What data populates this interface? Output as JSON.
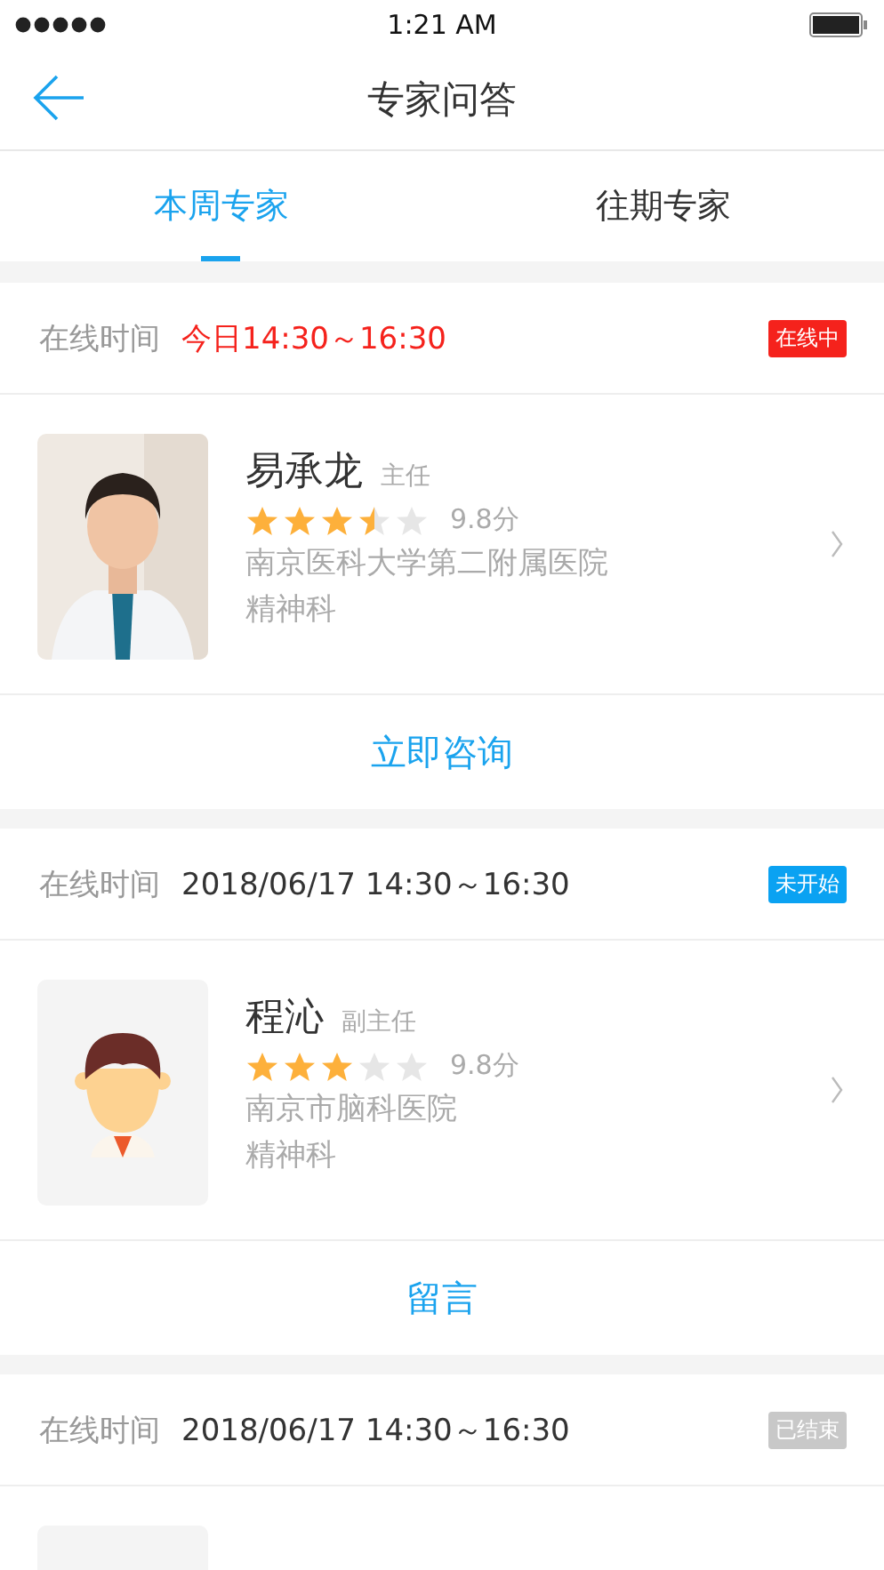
{
  "status_bar": {
    "time": "1:21 AM"
  },
  "nav": {
    "title": "专家问答"
  },
  "tabs": [
    {
      "label": "本周专家",
      "selected": true
    },
    {
      "label": "往期专家",
      "selected": false
    }
  ],
  "experts": [
    {
      "time_label": "在线时间",
      "time": "今日14:30～16:30",
      "status": {
        "kind": "online",
        "label": "在线中"
      },
      "name": "易承龙",
      "title": "主任",
      "stars": 3.5,
      "score": "9.8分",
      "hospital": "南京医科大学第二附属医院",
      "department": "精神科",
      "action": "立即咨询"
    },
    {
      "time_label": "在线时间",
      "time": "2018/06/17 14:30～16:30",
      "status": {
        "kind": "pending",
        "label": "未开始"
      },
      "avatar": {
        "kind": "cartoon"
      },
      "name": "程沁",
      "title": "副主任",
      "stars": 3,
      "score": "9.8分",
      "hospital": "南京市脑科医院",
      "department": "精神科",
      "action": "留言"
    },
    {
      "time_label": "在线时间",
      "time": "2018/06/17 14:30～16:30",
      "status": {
        "kind": "ended",
        "label": "已结束"
      },
      "avatar": {
        "kind": "blank"
      }
    }
  ]
}
